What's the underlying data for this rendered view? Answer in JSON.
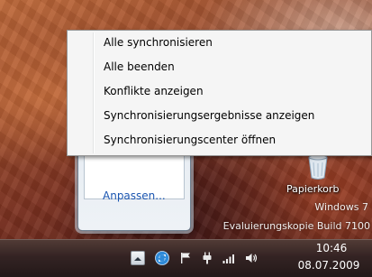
{
  "context_menu": {
    "items": [
      {
        "label": "Alle synchronisieren"
      },
      {
        "label": "Alle beenden"
      },
      {
        "label": "Konflikte anzeigen"
      },
      {
        "label": "Synchronisierungsergebnisse anzeigen"
      },
      {
        "label": "Synchronisierungscenter öffnen"
      }
    ]
  },
  "flyout": {
    "customize_link": "Anpassen..."
  },
  "desktop": {
    "recycle_bin_label": "Papierkorb",
    "watermark_line1": "Windows 7",
    "watermark_line2": "Evaluierungskopie Build 7100"
  },
  "taskbar": {
    "clock_time": "10:46",
    "clock_date": "08.07.2009",
    "tray_icons": [
      "show-hidden-icons-icon",
      "sync-center-icon",
      "action-center-flag-icon",
      "power-plug-icon",
      "network-signal-icon",
      "volume-icon"
    ]
  }
}
